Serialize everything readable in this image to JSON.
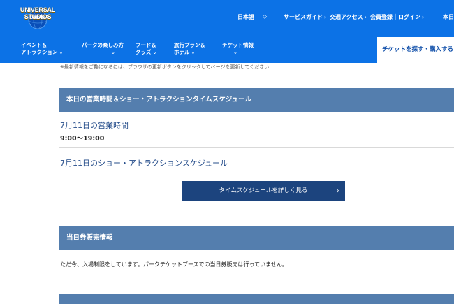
{
  "header": {
    "logo_main": "UNIVERSAL STUDIOS",
    "logo_sub": "JAPAN",
    "language": "日本語",
    "language_toggle": "◇",
    "links": [
      {
        "label": "サービスガイド",
        "chev": "›"
      },
      {
        "label": "交通アクセス",
        "chev": "›"
      },
      {
        "label": "会員登録｜ログイン",
        "chev": "›"
      },
      {
        "label": "本日",
        "chev": ""
      }
    ]
  },
  "nav": {
    "items": [
      {
        "line1": "イベント＆",
        "line2": "アトラクション",
        "chev": "⌄"
      },
      {
        "line1": "パークの楽しみ方",
        "line2": "",
        "chev": "⌄"
      },
      {
        "line1": "フード＆",
        "line2": "グッズ",
        "chev": "⌄"
      },
      {
        "line1": "旅行プラン＆",
        "line2": "ホテル",
        "chev": "⌄"
      },
      {
        "line1": "チケット情報",
        "line2": "",
        "chev": "⌄"
      }
    ],
    "ticket_button": "チケットを探す・購入する"
  },
  "main": {
    "notice": "※最新情報をご覧になるには、ブラウザの更新ボタンをクリックしてページを更新してください",
    "schedule_section_title": "本日の営業時間＆ショー・アトラクションタイムスケジュール",
    "hours_heading": "7月11日の営業時間",
    "hours_value": "9:00〜19:00",
    "show_heading": "7月11日のショー・アトラクションスケジュール",
    "detail_button": "タイムスケジュールを詳しく見る",
    "detail_button_chev": "›",
    "sale_section_title": "当日券販売情報",
    "sale_text": "ただ今、入場制限をしています。パークチケットブースでの当日券販売は行っていません。"
  },
  "colors": {
    "brand_blue": "#0c72e6",
    "section_header": "#547eae",
    "button_navy": "#1c447e",
    "heading_text": "#244c8a"
  }
}
